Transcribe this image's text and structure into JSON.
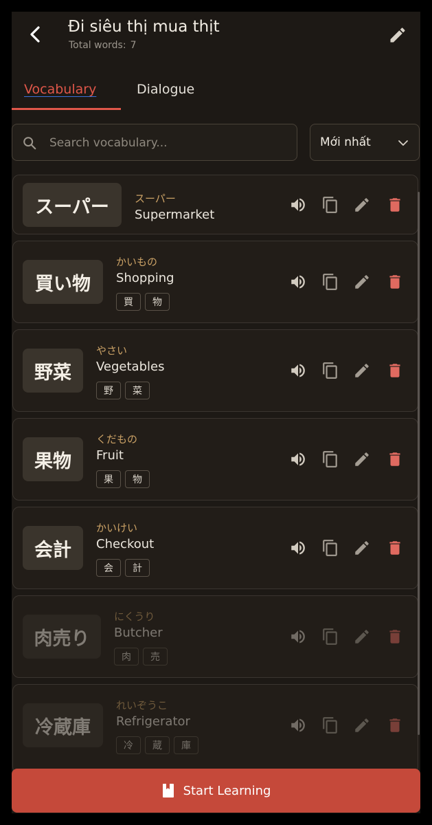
{
  "header": {
    "title": "Đi siêu thị mua thịt",
    "total_words_label": "Total words:",
    "total_words_count": "7"
  },
  "tabs": [
    {
      "label": "Vocabulary",
      "active": true
    },
    {
      "label": "Dialogue",
      "active": false
    }
  ],
  "search": {
    "placeholder": "Search vocabulary...",
    "value": ""
  },
  "sort": {
    "selected": "Mới nhất"
  },
  "vocabulary": [
    {
      "word": "スーパー",
      "reading": "スーパー",
      "meaning": "Supermarket",
      "kanji": []
    },
    {
      "word": "買い物",
      "reading": "かいもの",
      "meaning": "Shopping",
      "kanji": [
        "買",
        "物"
      ]
    },
    {
      "word": "野菜",
      "reading": "やさい",
      "meaning": "Vegetables",
      "kanji": [
        "野",
        "菜"
      ]
    },
    {
      "word": "果物",
      "reading": "くだもの",
      "meaning": "Fruit",
      "kanji": [
        "果",
        "物"
      ]
    },
    {
      "word": "会計",
      "reading": "かいけい",
      "meaning": "Checkout",
      "kanji": [
        "会",
        "計"
      ]
    },
    {
      "word": "肉売り",
      "reading": "にくうり",
      "meaning": "Butcher",
      "kanji": [
        "肉",
        "売"
      ]
    },
    {
      "word": "冷蔵庫",
      "reading": "れいぞうこ",
      "meaning": "Refrigerator",
      "kanji": [
        "冷",
        "蔵",
        "庫"
      ]
    }
  ],
  "footer": {
    "start_label": "Start Learning"
  },
  "colors": {
    "accent": "#e0574a",
    "delete": "#e06a60",
    "reading": "#cba266",
    "primary_button": "#c5493a",
    "background": "#1d1915"
  },
  "icons": {
    "back": "arrow-left-icon",
    "edit": "pencil-icon",
    "search": "search-icon",
    "sort": "chevron-down-icon",
    "speak": "speaker-icon",
    "copy": "copy-icon",
    "delete": "trash-icon",
    "start": "book-icon"
  }
}
